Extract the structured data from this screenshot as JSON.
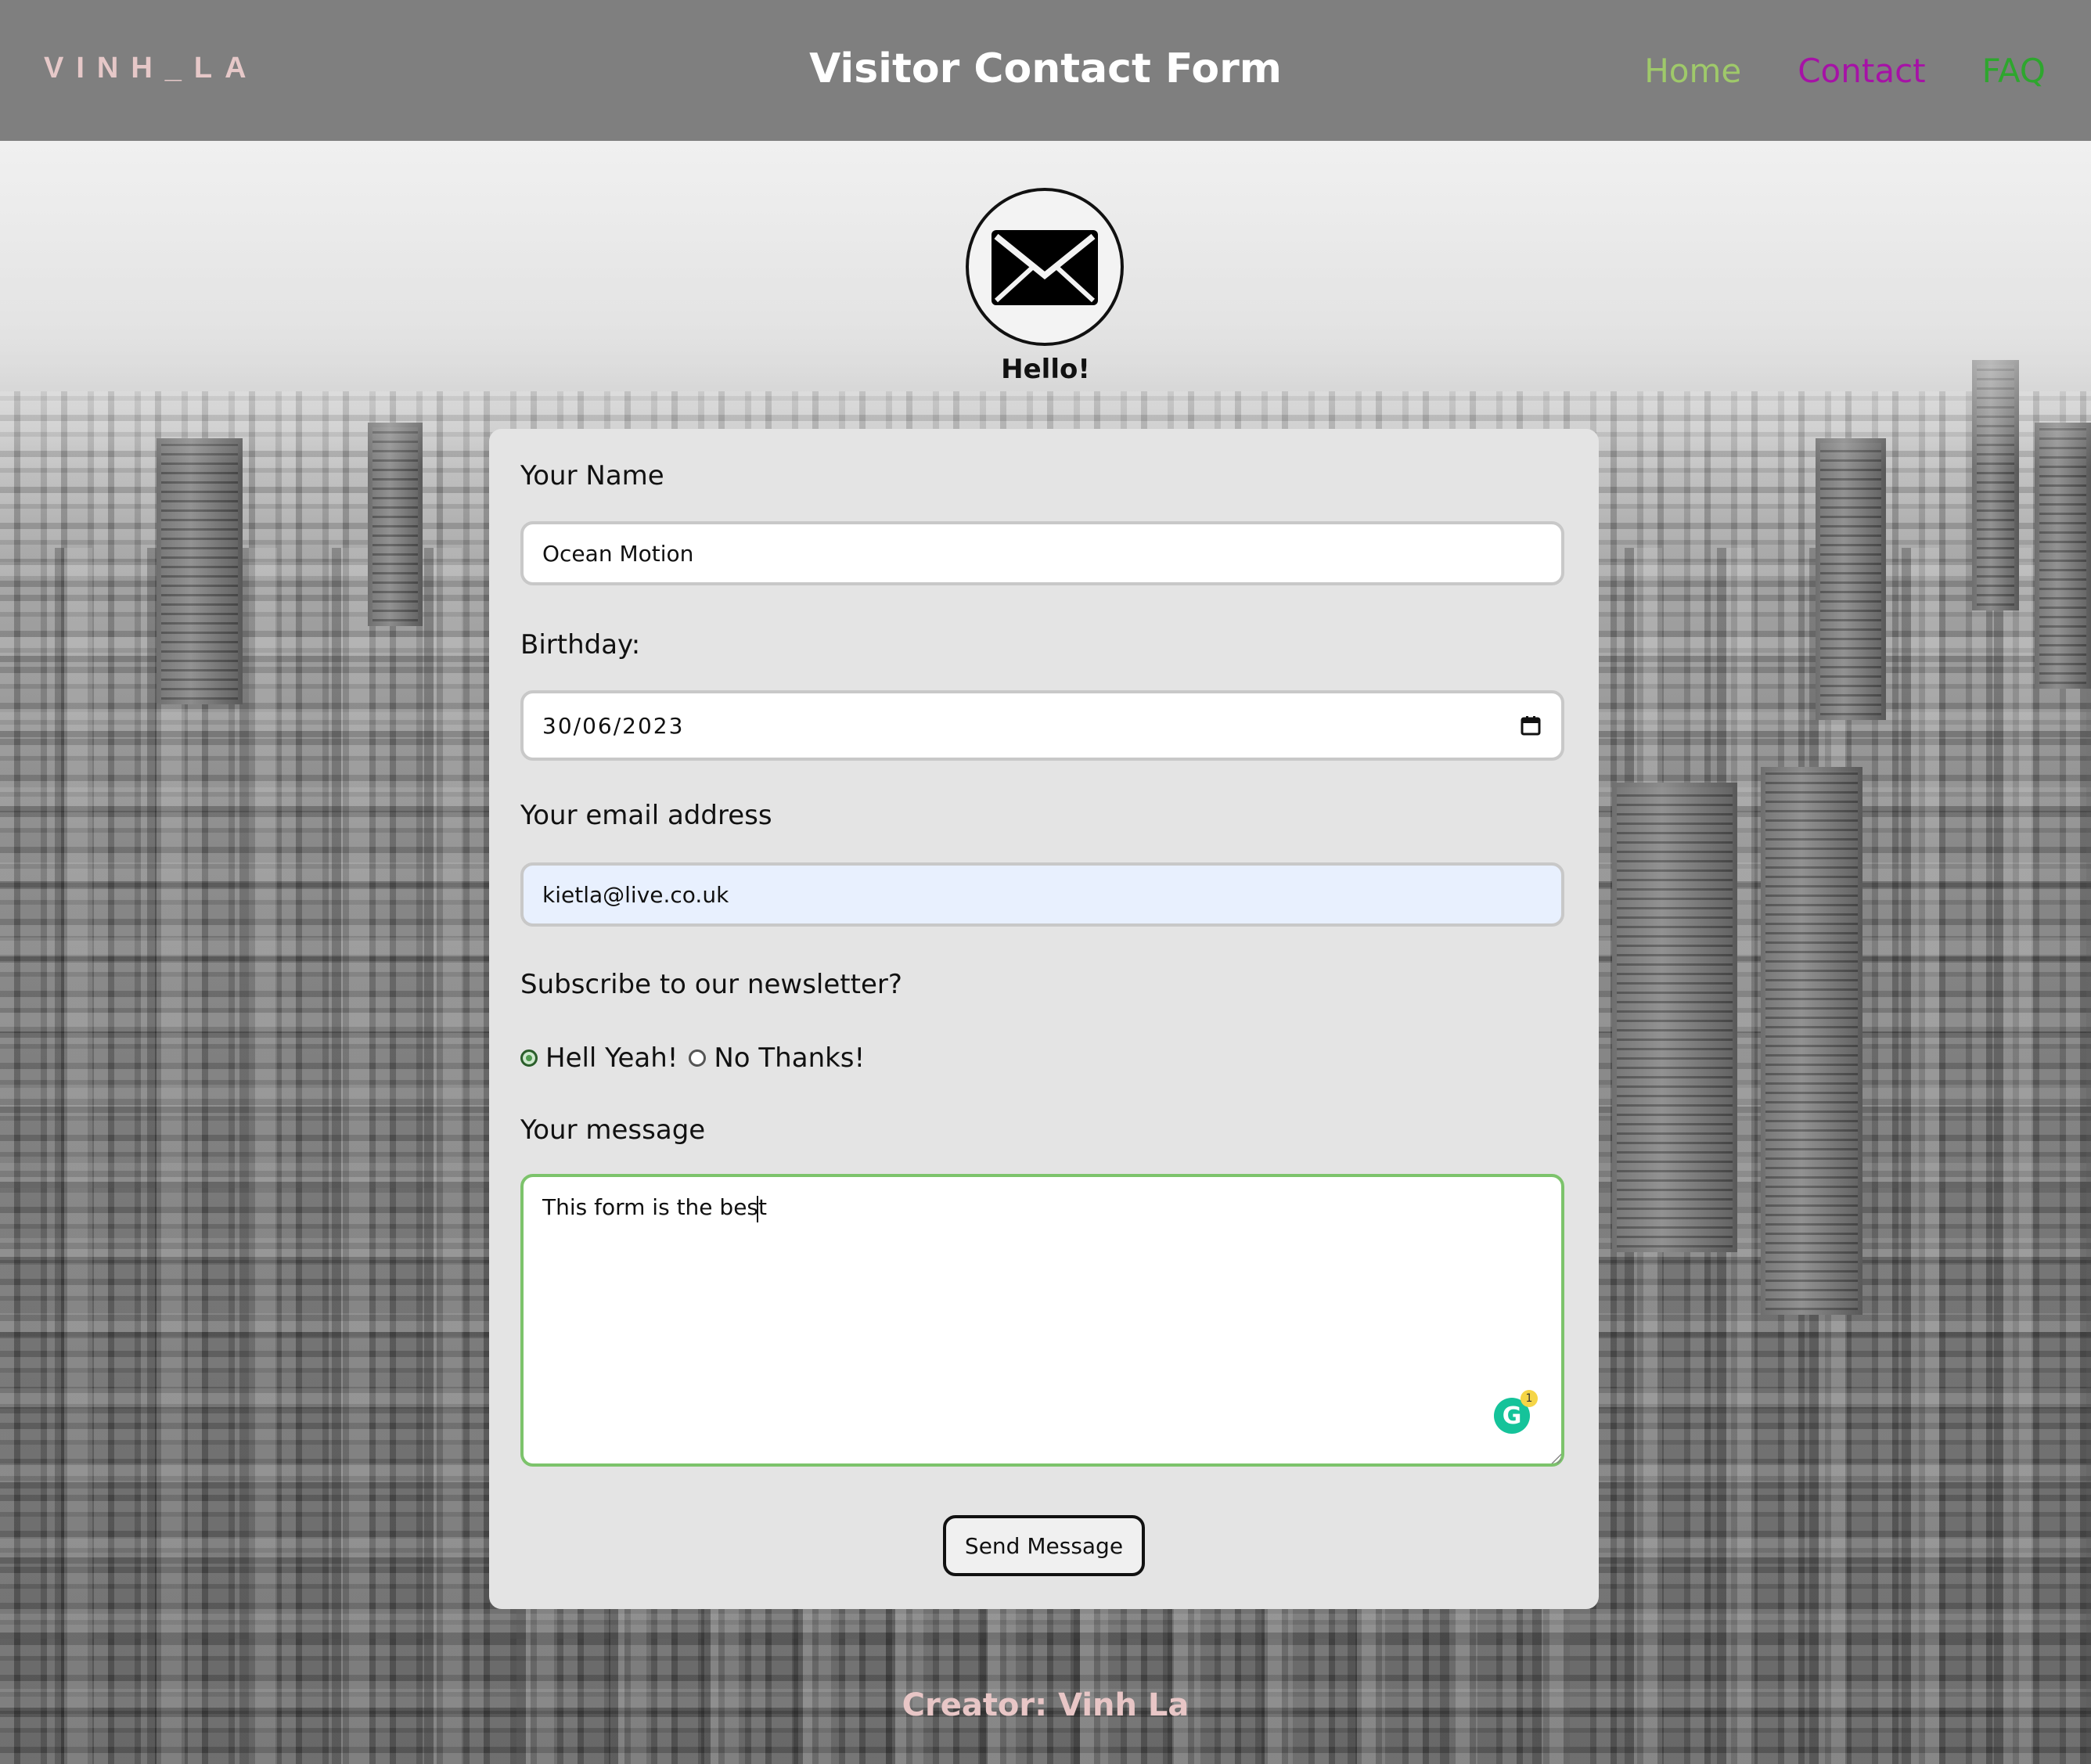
{
  "header": {
    "brand": "VINH_LA",
    "title": "Visitor Contact Form",
    "nav": {
      "home": "Home",
      "contact": "Contact",
      "faq": "FAQ"
    },
    "colors": {
      "home": "#9fc96a",
      "contact": "#a612a6",
      "faq": "#2ea62e"
    }
  },
  "hero": {
    "icon": "envelope-icon",
    "greeting": "Hello!"
  },
  "form": {
    "name_label": "Your Name",
    "name_value": "Ocean Motion",
    "birthday_label": "Birthday:",
    "birthday_value": "30/06/2023",
    "email_label": "Your email address",
    "email_value": "kietla@live.co.uk",
    "newsletter_label": "Subscribe to our newsletter?",
    "newsletter_options": [
      {
        "label": "Hell Yeah!",
        "selected": true
      },
      {
        "label": "No Thanks!",
        "selected": false
      }
    ],
    "message_label": "Your message",
    "message_value": "This form is the best ",
    "grammarly_count": "1",
    "submit_label": "Send Message"
  },
  "footer": {
    "credit": "Creator: Vinh La"
  }
}
